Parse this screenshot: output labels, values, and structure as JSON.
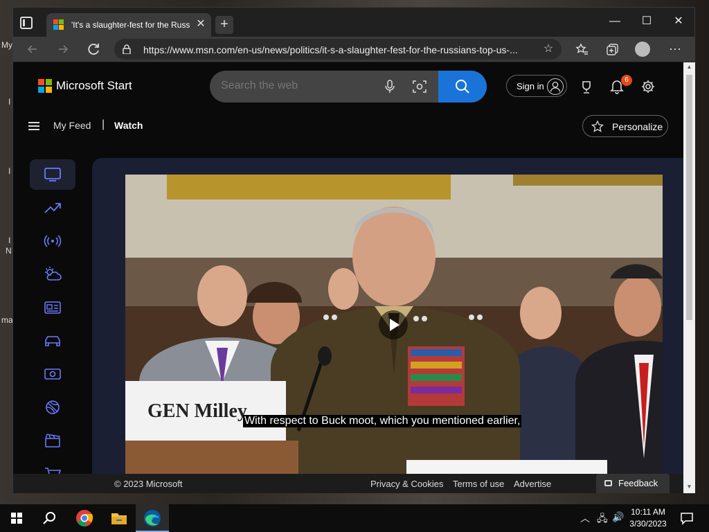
{
  "desktop": {
    "left_labels": [
      "My",
      "I",
      "I",
      "I",
      "N",
      "ma"
    ]
  },
  "browser": {
    "tab": {
      "title": "'It's a slaughter-fest for the Russ",
      "close_glyph": "✕"
    },
    "new_tab_glyph": "+",
    "window_controls": {
      "minimize": "—",
      "maximize": "☐",
      "close": "✕"
    },
    "address": {
      "url": "https://www.msn.com/en-us/news/politics/it-s-a-slaughter-fest-for-the-russians-top-us-..."
    }
  },
  "site": {
    "brand": "Microsoft Start",
    "search": {
      "placeholder": "Search the web"
    },
    "sign_in": "Sign in",
    "notification_count": "6",
    "nav": {
      "my_feed": "My Feed",
      "separator": "|",
      "watch": "Watch"
    },
    "personalize": "Personalize",
    "rail_items": [
      "video-icon",
      "trending-icon",
      "live-icon",
      "weather-icon",
      "news-icon",
      "autos-icon",
      "money-icon",
      "sports-icon",
      "movies-icon",
      "shopping-icon"
    ],
    "video": {
      "caption": "With respect to Buck moot, which you mentioned earlier,",
      "nameplate": "GEN Milley"
    },
    "footer": {
      "copyright": "© 2023 Microsoft",
      "privacy": "Privacy & Cookies",
      "terms": "Terms of use",
      "advertise": "Advertise",
      "feedback": "Feedback"
    }
  },
  "taskbar": {
    "time": "10:11 AM",
    "date": "3/30/2023"
  },
  "colors": {
    "accent_blue": "#1a73d9",
    "badge_orange": "#e14b16",
    "rail_active": "#1e2130",
    "video_panel": "#1b1f33"
  }
}
